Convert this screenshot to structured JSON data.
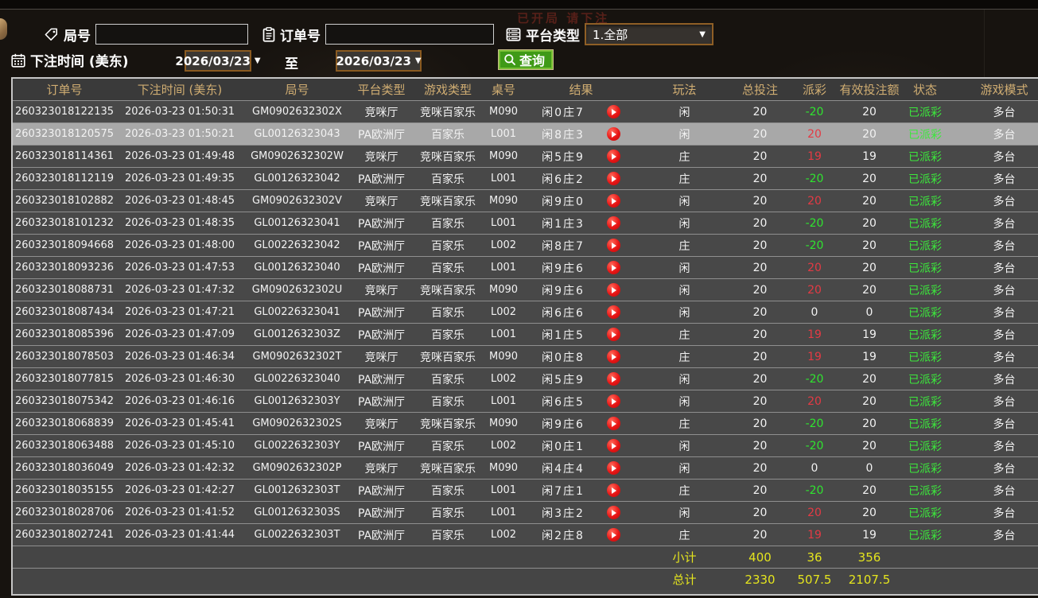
{
  "background": {
    "ghost_text": "已开局 请下注"
  },
  "filters": {
    "game_no": {
      "label": "局号",
      "value": "",
      "icon": "tag-icon"
    },
    "order_no": {
      "label": "订单号",
      "value": "",
      "icon": "clipboard-icon"
    },
    "platform": {
      "label": "平台类型",
      "value": "1.全部",
      "icon": "server-icon"
    },
    "bet_time": {
      "label": "下注时间 (美东)",
      "icon": "calendar-icon",
      "from": "2026/03/23",
      "to_label": "至",
      "to": "2026/03/23"
    },
    "query": {
      "label": "查询",
      "icon": "magnifier-icon"
    }
  },
  "table": {
    "headers": [
      "订单号",
      "下注时间 (美东)",
      "局号",
      "平台类型",
      "游戏类型",
      "桌号",
      "结果",
      "玩法",
      "总投注",
      "派彩",
      "有效投注额",
      "状态",
      "游戏模式"
    ],
    "rows": [
      {
        "order_no": "260323018122135",
        "bet_time": "2026-03-23 01:50:31",
        "game_no": "GM0902632302X",
        "platform": "竞咪厅",
        "game_type": "竞咪百家乐",
        "table_no": "M090",
        "result": "闲0庄7",
        "play": "闲",
        "total_bet": "20",
        "payout": "-20",
        "valid_bet": "20",
        "status": "已派彩",
        "mode": "多台",
        "selected": false
      },
      {
        "order_no": "260323018120575",
        "bet_time": "2026-03-23 01:50:21",
        "game_no": "GL00126323043",
        "platform": "PA欧洲厅",
        "game_type": "百家乐",
        "table_no": "L001",
        "result": "闲8庄3",
        "play": "闲",
        "total_bet": "20",
        "payout": "20",
        "valid_bet": "20",
        "status": "已派彩",
        "mode": "多台",
        "selected": true
      },
      {
        "order_no": "260323018114361",
        "bet_time": "2026-03-23 01:49:48",
        "game_no": "GM0902632302W",
        "platform": "竞咪厅",
        "game_type": "竞咪百家乐",
        "table_no": "M090",
        "result": "闲5庄9",
        "play": "庄",
        "total_bet": "20",
        "payout": "19",
        "valid_bet": "19",
        "status": "已派彩",
        "mode": "多台",
        "selected": false
      },
      {
        "order_no": "260323018112119",
        "bet_time": "2026-03-23 01:49:35",
        "game_no": "GL00126323042",
        "platform": "PA欧洲厅",
        "game_type": "百家乐",
        "table_no": "L001",
        "result": "闲6庄2",
        "play": "庄",
        "total_bet": "20",
        "payout": "-20",
        "valid_bet": "20",
        "status": "已派彩",
        "mode": "多台",
        "selected": false
      },
      {
        "order_no": "260323018102882",
        "bet_time": "2026-03-23 01:48:45",
        "game_no": "GM0902632302V",
        "platform": "竞咪厅",
        "game_type": "竞咪百家乐",
        "table_no": "M090",
        "result": "闲9庄0",
        "play": "闲",
        "total_bet": "20",
        "payout": "20",
        "valid_bet": "20",
        "status": "已派彩",
        "mode": "多台",
        "selected": false
      },
      {
        "order_no": "260323018101232",
        "bet_time": "2026-03-23 01:48:35",
        "game_no": "GL00126323041",
        "platform": "PA欧洲厅",
        "game_type": "百家乐",
        "table_no": "L001",
        "result": "闲1庄3",
        "play": "闲",
        "total_bet": "20",
        "payout": "-20",
        "valid_bet": "20",
        "status": "已派彩",
        "mode": "多台",
        "selected": false
      },
      {
        "order_no": "260323018094668",
        "bet_time": "2026-03-23 01:48:00",
        "game_no": "GL00226323042",
        "platform": "PA欧洲厅",
        "game_type": "百家乐",
        "table_no": "L002",
        "result": "闲8庄7",
        "play": "庄",
        "total_bet": "20",
        "payout": "-20",
        "valid_bet": "20",
        "status": "已派彩",
        "mode": "多台",
        "selected": false
      },
      {
        "order_no": "260323018093236",
        "bet_time": "2026-03-23 01:47:53",
        "game_no": "GL00126323040",
        "platform": "PA欧洲厅",
        "game_type": "百家乐",
        "table_no": "L001",
        "result": "闲9庄6",
        "play": "闲",
        "total_bet": "20",
        "payout": "20",
        "valid_bet": "20",
        "status": "已派彩",
        "mode": "多台",
        "selected": false
      },
      {
        "order_no": "260323018088731",
        "bet_time": "2026-03-23 01:47:32",
        "game_no": "GM0902632302U",
        "platform": "竞咪厅",
        "game_type": "竞咪百家乐",
        "table_no": "M090",
        "result": "闲9庄6",
        "play": "闲",
        "total_bet": "20",
        "payout": "20",
        "valid_bet": "20",
        "status": "已派彩",
        "mode": "多台",
        "selected": false
      },
      {
        "order_no": "260323018087434",
        "bet_time": "2026-03-23 01:47:21",
        "game_no": "GL00226323041",
        "platform": "PA欧洲厅",
        "game_type": "百家乐",
        "table_no": "L002",
        "result": "闲6庄6",
        "play": "闲",
        "total_bet": "20",
        "payout": "0",
        "valid_bet": "0",
        "status": "已派彩",
        "mode": "多台",
        "selected": false
      },
      {
        "order_no": "260323018085396",
        "bet_time": "2026-03-23 01:47:09",
        "game_no": "GL0012632303Z",
        "platform": "PA欧洲厅",
        "game_type": "百家乐",
        "table_no": "L001",
        "result": "闲1庄5",
        "play": "庄",
        "total_bet": "20",
        "payout": "19",
        "valid_bet": "19",
        "status": "已派彩",
        "mode": "多台",
        "selected": false
      },
      {
        "order_no": "260323018078503",
        "bet_time": "2026-03-23 01:46:34",
        "game_no": "GM0902632302T",
        "platform": "竞咪厅",
        "game_type": "竞咪百家乐",
        "table_no": "M090",
        "result": "闲0庄8",
        "play": "庄",
        "total_bet": "20",
        "payout": "19",
        "valid_bet": "19",
        "status": "已派彩",
        "mode": "多台",
        "selected": false
      },
      {
        "order_no": "260323018077815",
        "bet_time": "2026-03-23 01:46:30",
        "game_no": "GL00226323040",
        "platform": "PA欧洲厅",
        "game_type": "百家乐",
        "table_no": "L002",
        "result": "闲5庄9",
        "play": "闲",
        "total_bet": "20",
        "payout": "-20",
        "valid_bet": "20",
        "status": "已派彩",
        "mode": "多台",
        "selected": false
      },
      {
        "order_no": "260323018075342",
        "bet_time": "2026-03-23 01:46:16",
        "game_no": "GL0012632303Y",
        "platform": "PA欧洲厅",
        "game_type": "百家乐",
        "table_no": "L001",
        "result": "闲6庄5",
        "play": "闲",
        "total_bet": "20",
        "payout": "20",
        "valid_bet": "20",
        "status": "已派彩",
        "mode": "多台",
        "selected": false
      },
      {
        "order_no": "260323018068839",
        "bet_time": "2026-03-23 01:45:41",
        "game_no": "GM0902632302S",
        "platform": "竞咪厅",
        "game_type": "竞咪百家乐",
        "table_no": "M090",
        "result": "闲9庄6",
        "play": "庄",
        "total_bet": "20",
        "payout": "-20",
        "valid_bet": "20",
        "status": "已派彩",
        "mode": "多台",
        "selected": false
      },
      {
        "order_no": "260323018063488",
        "bet_time": "2026-03-23 01:45:10",
        "game_no": "GL0022632303Y",
        "platform": "PA欧洲厅",
        "game_type": "百家乐",
        "table_no": "L002",
        "result": "闲0庄1",
        "play": "闲",
        "total_bet": "20",
        "payout": "-20",
        "valid_bet": "20",
        "status": "已派彩",
        "mode": "多台",
        "selected": false
      },
      {
        "order_no": "260323018036049",
        "bet_time": "2026-03-23 01:42:32",
        "game_no": "GM0902632302P",
        "platform": "竞咪厅",
        "game_type": "竞咪百家乐",
        "table_no": "M090",
        "result": "闲4庄4",
        "play": "闲",
        "total_bet": "20",
        "payout": "0",
        "valid_bet": "0",
        "status": "已派彩",
        "mode": "多台",
        "selected": false
      },
      {
        "order_no": "260323018035155",
        "bet_time": "2026-03-23 01:42:27",
        "game_no": "GL0012632303T",
        "platform": "PA欧洲厅",
        "game_type": "百家乐",
        "table_no": "L001",
        "result": "闲7庄1",
        "play": "庄",
        "total_bet": "20",
        "payout": "-20",
        "valid_bet": "20",
        "status": "已派彩",
        "mode": "多台",
        "selected": false
      },
      {
        "order_no": "260323018028706",
        "bet_time": "2026-03-23 01:41:52",
        "game_no": "GL0012632303S",
        "platform": "PA欧洲厅",
        "game_type": "百家乐",
        "table_no": "L001",
        "result": "闲3庄2",
        "play": "闲",
        "total_bet": "20",
        "payout": "20",
        "valid_bet": "20",
        "status": "已派彩",
        "mode": "多台",
        "selected": false
      },
      {
        "order_no": "260323018027241",
        "bet_time": "2026-03-23 01:41:44",
        "game_no": "GL0022632303T",
        "platform": "PA欧洲厅",
        "game_type": "百家乐",
        "table_no": "L002",
        "result": "闲2庄8",
        "play": "庄",
        "total_bet": "20",
        "payout": "19",
        "valid_bet": "19",
        "status": "已派彩",
        "mode": "多台",
        "selected": false
      }
    ],
    "subtotal": {
      "label": "小计",
      "total_bet": "400",
      "payout": "36",
      "valid_bet": "356"
    },
    "grand_total": {
      "label": "总计",
      "total_bet": "2330",
      "payout": "507.5",
      "valid_bet": "2107.5"
    }
  },
  "colors": {
    "header_gold": "#d0ad72",
    "win_red": "#e43a44",
    "lose_green": "#2fe42f",
    "status_green": "#3ce83c",
    "sum_yellow": "#e4e41e",
    "query_green": "#3f9a17",
    "date_border": "#8a5a20",
    "selected_row": "#a8a8a8"
  }
}
